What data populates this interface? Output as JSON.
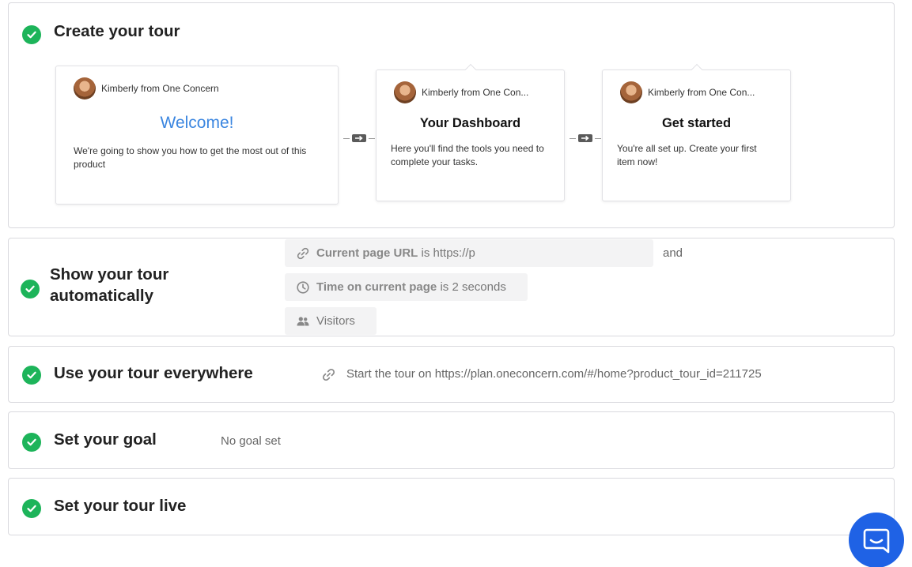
{
  "sections": {
    "create": {
      "title": "Create your tour",
      "cards": [
        {
          "author": "Kimberly from One Concern",
          "heading": "Welcome!",
          "body": "We're going to show you how to get the most out of this product"
        },
        {
          "author": "Kimberly from One Con...",
          "heading": "Your Dashboard",
          "body": "Here you'll find the tools you need to complete your tasks."
        },
        {
          "author": "Kimberly from One Con...",
          "heading": "Get started",
          "body": "You're all set up. Create your first item now!"
        }
      ]
    },
    "show_auto": {
      "title": "Show your tour automatically",
      "rule_url": {
        "label": "Current page URL",
        "op": "is",
        "value": "https://p"
      },
      "joiner": "and",
      "rule_time": {
        "label": "Time on current page",
        "op": "is",
        "value": "2 seconds"
      },
      "rule_visitors": {
        "label": "Visitors"
      }
    },
    "everywhere": {
      "title": "Use your tour everywhere",
      "text": "Start the tour on https://plan.oneconcern.com/#/home?product_tour_id=211725"
    },
    "goal": {
      "title": "Set your goal",
      "text": "No goal set"
    },
    "live": {
      "title": "Set your tour live"
    }
  },
  "icons": {
    "check": "check-icon",
    "link": "link-icon",
    "clock": "clock-icon",
    "people": "people-icon",
    "messenger": "messenger-icon"
  },
  "colors": {
    "check_green": "#1db45a",
    "welcome_blue": "#3b86e0",
    "messenger_blue": "#1f62e5"
  }
}
